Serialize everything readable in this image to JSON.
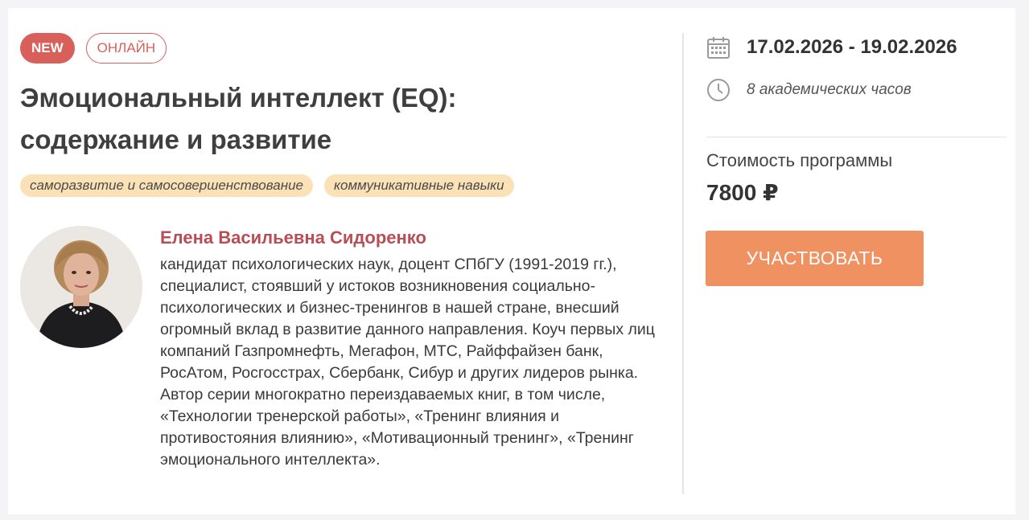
{
  "badges": {
    "new": "NEW",
    "online": "ОНЛАЙН"
  },
  "course": {
    "title": "Эмоциональный интеллект (EQ): содержание и развитие",
    "tags": [
      "саморазвитие и самосовершенствование",
      "коммуникативные навыки"
    ]
  },
  "teacher": {
    "name": "Елена Васильевна Сидоренко",
    "bio": "кандидат психологических наук, доцент СПбГУ (1991-2019 гг.), специалист, стоявший у истоков возникновения социально-психологических и бизнес-тренингов в нашей стране, внесший огромный вклад в развитие данного направления. Коуч первых лиц компаний Газпромнефть, Мегафон, МТС, Райффайзен банк, РосАтом, Росгосстрах, Сбербанк, Сибур и других лидеров рынка. Автор серии многократно переиздаваемых книг, в том числе, «Технологии тренерской работы», «Тренинг влияния и противостояния влиянию», «Мотивационный тренинг», «Тренинг эмоционального интеллекта»."
  },
  "schedule": {
    "dates": "17.02.2026 - 19.02.2026",
    "hours": "8 академических часов",
    "icons": [
      "calendar-icon",
      "clock-icon"
    ]
  },
  "pricing": {
    "label": "Стоимость программы",
    "value": "7800 ₽",
    "cta": "УЧАСТВОВАТЬ"
  },
  "colors": {
    "badge_red": "#d9605a",
    "tag_bg": "#fbe2b6",
    "teacher_name": "#b84e55",
    "cta_bg": "#ef9160"
  }
}
